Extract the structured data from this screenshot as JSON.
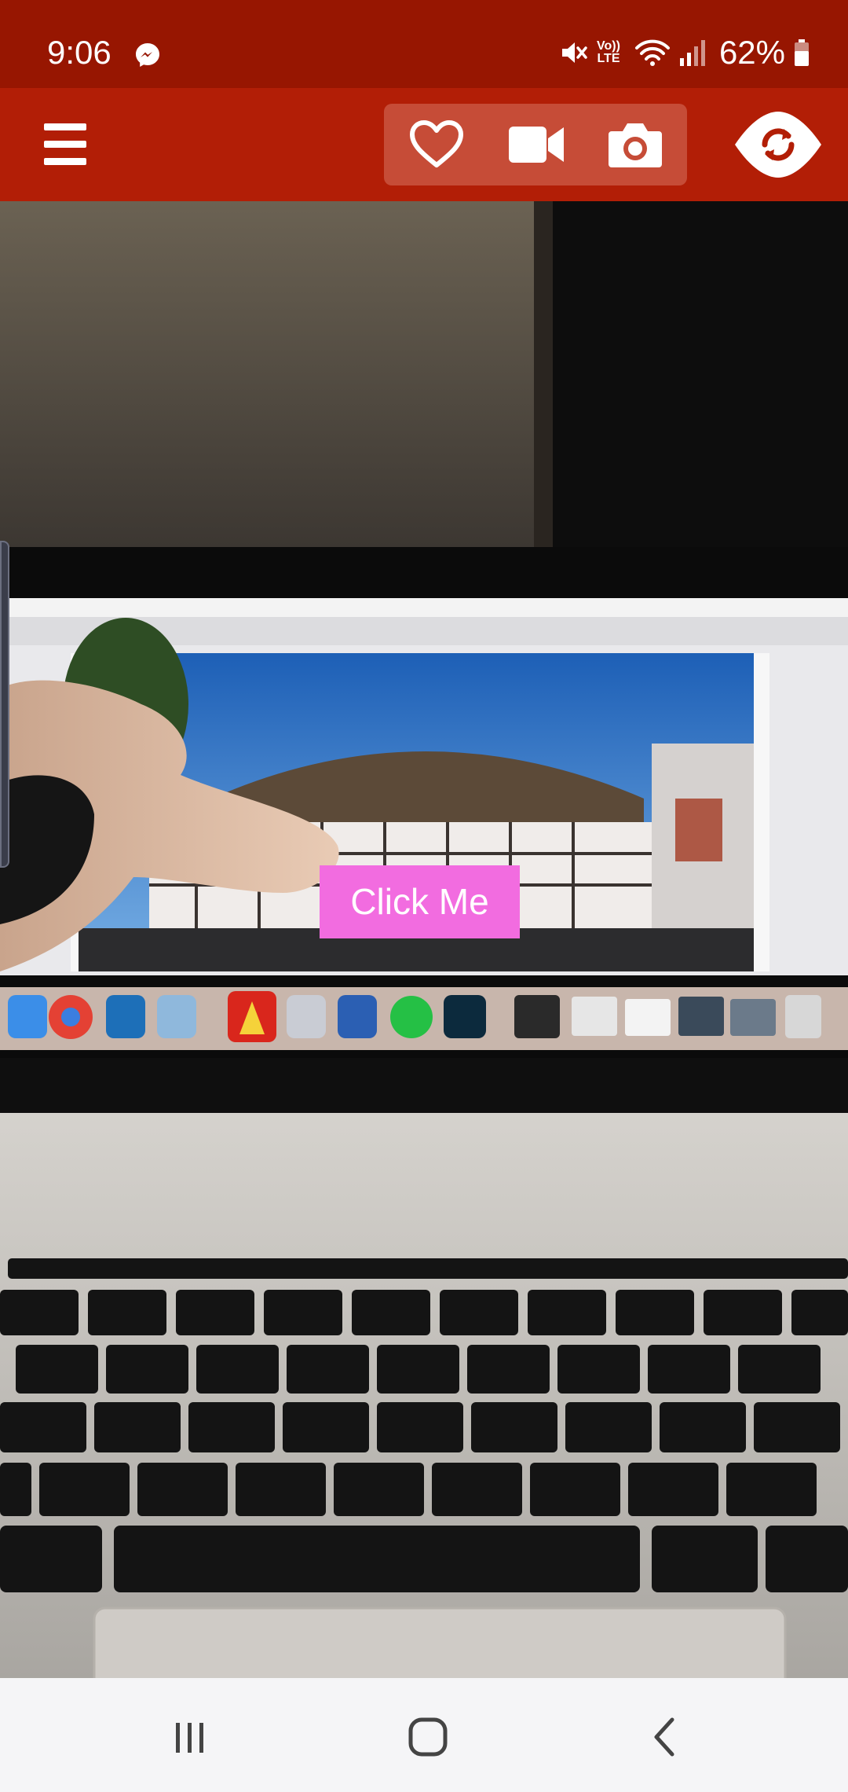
{
  "status_bar": {
    "time": "9:06",
    "volte_top": "Vo))",
    "volte_bottom": "LTE",
    "battery_percent": "62%",
    "icons": [
      "messenger-icon",
      "mute-icon",
      "volte-icon",
      "wifi-icon",
      "signal-icon",
      "battery-icon"
    ]
  },
  "toolbar": {
    "icons": [
      "menu-icon",
      "heart-icon",
      "video-camera-icon",
      "camera-icon",
      "switch-camera-icon"
    ]
  },
  "camera_view": {
    "overlay_button_label": "Click Me"
  },
  "nav_bar": {
    "icons": [
      "recent-apps-icon",
      "home-icon",
      "back-icon"
    ]
  },
  "colors": {
    "status_bar": "#971601",
    "toolbar": "#b21e06",
    "action_group": "#c64c37",
    "overlay_button": "#f26ce0",
    "nav_bar": "#f5f5f7"
  }
}
